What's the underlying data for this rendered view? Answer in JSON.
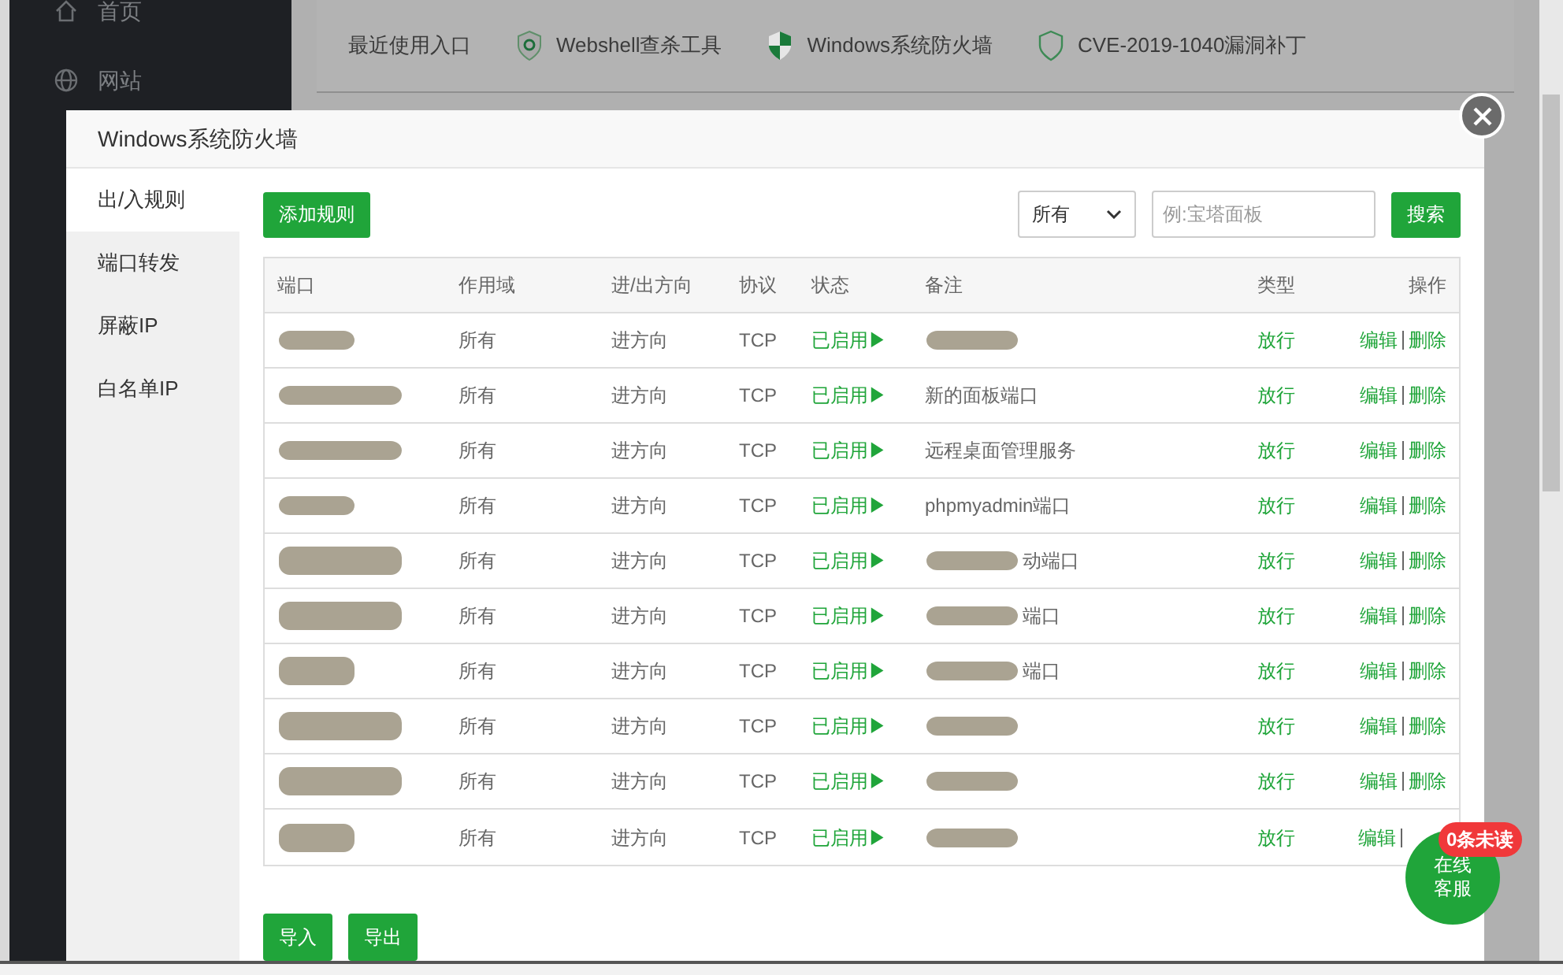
{
  "sidebar": {
    "items": [
      {
        "label": "首页"
      },
      {
        "label": "网站"
      }
    ]
  },
  "quick_links": {
    "label": "最近使用入口",
    "items": [
      {
        "label": "Webshell查杀工具"
      },
      {
        "label": "Windows系统防火墙"
      },
      {
        "label": "CVE-2019-1040漏洞补丁"
      }
    ]
  },
  "dialog": {
    "title": "Windows系统防火墙",
    "tabs": [
      {
        "label": "出/入规则",
        "selected": true
      },
      {
        "label": "端口转发",
        "selected": false
      },
      {
        "label": "屏蔽IP",
        "selected": false
      },
      {
        "label": "白名单IP",
        "selected": false
      }
    ],
    "add_button": "添加规则",
    "filter": {
      "value": "所有"
    },
    "search": {
      "placeholder": "例:宝塔面板",
      "button": "搜索"
    },
    "table": {
      "columns": [
        "端口",
        "作用域",
        "进/出方向",
        "协议",
        "状态",
        "备注",
        "类型",
        "操作"
      ],
      "rows": [
        {
          "port_redacted": true,
          "scope": "所有",
          "direction": "进方向",
          "protocol": "TCP",
          "status": "已启用▶",
          "note_redacted": true,
          "type": "放行",
          "edit": "编辑",
          "delete": "删除"
        },
        {
          "port_redacted": true,
          "scope": "所有",
          "direction": "进方向",
          "protocol": "TCP",
          "status": "已启用▶",
          "note": "新的面板端口",
          "note_redacted": false,
          "type": "放行",
          "edit": "编辑",
          "delete": "删除"
        },
        {
          "port_redacted": true,
          "scope": "所有",
          "direction": "进方向",
          "protocol": "TCP",
          "status": "已启用▶",
          "note": "远程桌面管理服务",
          "note_redacted": false,
          "type": "放行",
          "edit": "编辑",
          "delete": "删除"
        },
        {
          "port_redacted": true,
          "scope": "所有",
          "direction": "进方向",
          "protocol": "TCP",
          "status": "已启用▶",
          "note": "phpmyadmin端口",
          "note_redacted": false,
          "type": "放行",
          "edit": "编辑",
          "delete": "删除"
        },
        {
          "port_redacted": true,
          "scope": "所有",
          "direction": "进方向",
          "protocol": "TCP",
          "status": "已启用▶",
          "note": "动端口",
          "note_redacted": true,
          "type": "放行",
          "edit": "编辑",
          "delete": "删除"
        },
        {
          "port_redacted": true,
          "scope": "所有",
          "direction": "进方向",
          "protocol": "TCP",
          "status": "已启用▶",
          "note": "端口",
          "note_redacted": true,
          "type": "放行",
          "edit": "编辑",
          "delete": "删除"
        },
        {
          "port_redacted": true,
          "scope": "所有",
          "direction": "进方向",
          "protocol": "TCP",
          "status": "已启用▶",
          "note": "端口",
          "note_redacted": true,
          "type": "放行",
          "edit": "编辑",
          "delete": "删除"
        },
        {
          "port_redacted": true,
          "scope": "所有",
          "direction": "进方向",
          "protocol": "TCP",
          "status": "已启用▶",
          "note_redacted": true,
          "type": "放行",
          "edit": "编辑",
          "delete": "删除"
        },
        {
          "port_redacted": true,
          "scope": "所有",
          "direction": "进方向",
          "protocol": "TCP",
          "status": "已启用▶",
          "note_redacted": true,
          "type": "放行",
          "edit": "编辑",
          "delete": "删除"
        },
        {
          "port_redacted": true,
          "scope": "所有",
          "direction": "进方向",
          "protocol": "TCP",
          "status": "已启用▶",
          "note_redacted": true,
          "type": "放行",
          "edit": "编辑"
        }
      ]
    },
    "footer_buttons": [
      "导入",
      "导出"
    ]
  },
  "chat_widget": {
    "label": "在线客服",
    "badge": "0条未读"
  }
}
